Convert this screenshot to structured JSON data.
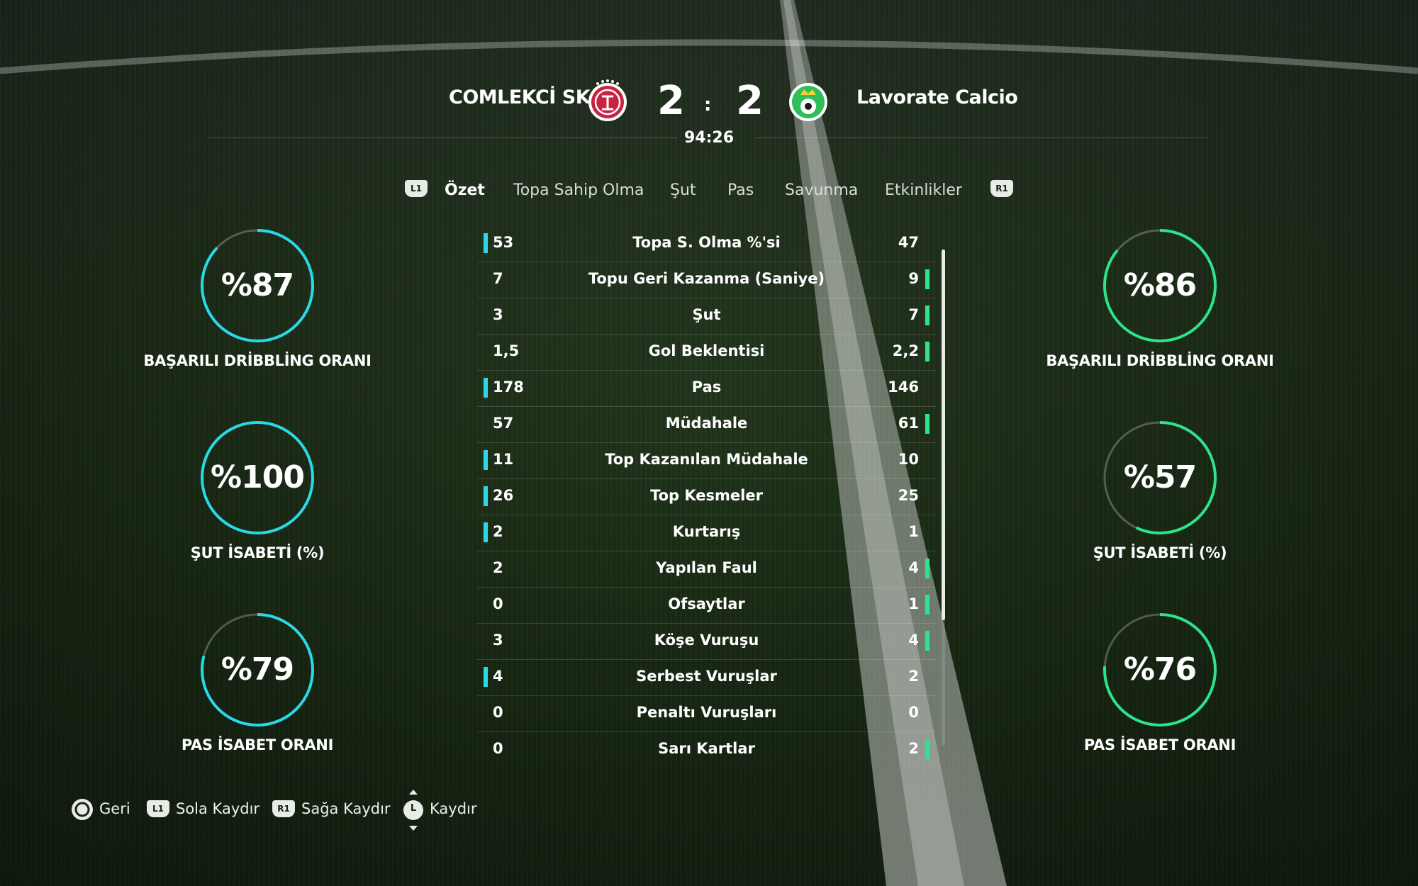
{
  "match": {
    "home_team": "COMLEKCİ SK",
    "away_team": "Lavorate Calcio",
    "home_score": "2",
    "away_score": "2",
    "separator": ":",
    "clock": "94:26"
  },
  "tabs": {
    "prev_bumper": "L1",
    "next_bumper": "R1",
    "items": [
      "Özet",
      "Topa Sahip Olma",
      "Şut",
      "Pas",
      "Savunma",
      "Etkinlikler"
    ],
    "active": "Özet"
  },
  "colors": {
    "home_accent": "#29d9e6",
    "away_accent": "#2de38b",
    "home_crest": "#c8243f",
    "away_crest": "#2fbf5a"
  },
  "home_rings": [
    {
      "value": "%87",
      "pct": 87,
      "label": "BAŞARILI DRİBBLİNG ORANI"
    },
    {
      "value": "%100",
      "pct": 100,
      "label": "ŞUT İSABETİ (%)"
    },
    {
      "value": "%79",
      "pct": 79,
      "label": "PAS İSABET ORANI"
    }
  ],
  "away_rings": [
    {
      "value": "%86",
      "pct": 86,
      "label": "BAŞARILI DRİBBLİNG ORANI"
    },
    {
      "value": "%57",
      "pct": 57,
      "label": "ŞUT İSABETİ (%)"
    },
    {
      "value": "%76",
      "pct": 76,
      "label": "PAS İSABET ORANI"
    }
  ],
  "stats": [
    {
      "home": "53",
      "name": "Topa S. Olma %'si",
      "away": "47",
      "leader": "home"
    },
    {
      "home": "7",
      "name": "Topu Geri Kazanma (Saniye)",
      "away": "9",
      "leader": "away"
    },
    {
      "home": "3",
      "name": "Şut",
      "away": "7",
      "leader": "away"
    },
    {
      "home": "1,5",
      "name": "Gol Beklentisi",
      "away": "2,2",
      "leader": "away"
    },
    {
      "home": "178",
      "name": "Pas",
      "away": "146",
      "leader": "home"
    },
    {
      "home": "57",
      "name": "Müdahale",
      "away": "61",
      "leader": "away"
    },
    {
      "home": "11",
      "name": "Top Kazanılan Müdahale",
      "away": "10",
      "leader": "home"
    },
    {
      "home": "26",
      "name": "Top Kesmeler",
      "away": "25",
      "leader": "home"
    },
    {
      "home": "2",
      "name": "Kurtarış",
      "away": "1",
      "leader": "home"
    },
    {
      "home": "2",
      "name": "Yapılan Faul",
      "away": "4",
      "leader": "away"
    },
    {
      "home": "0",
      "name": "Ofsaytlar",
      "away": "1",
      "leader": "away"
    },
    {
      "home": "3",
      "name": "Köşe Vuruşu",
      "away": "4",
      "leader": "away"
    },
    {
      "home": "4",
      "name": "Serbest Vuruşlar",
      "away": "2",
      "leader": "home"
    },
    {
      "home": "0",
      "name": "Penaltı Vuruşları",
      "away": "0",
      "leader": "none"
    },
    {
      "home": "0",
      "name": "Sarı Kartlar",
      "away": "2",
      "leader": "away"
    }
  ],
  "footer": {
    "back": {
      "icon": "circle-button-icon",
      "label": "Geri"
    },
    "left": {
      "icon": "L1",
      "label": "Sola Kaydır"
    },
    "right": {
      "icon": "R1",
      "label": "Sağa Kaydır"
    },
    "scroll": {
      "icon": "L",
      "label": "Kaydır"
    }
  }
}
